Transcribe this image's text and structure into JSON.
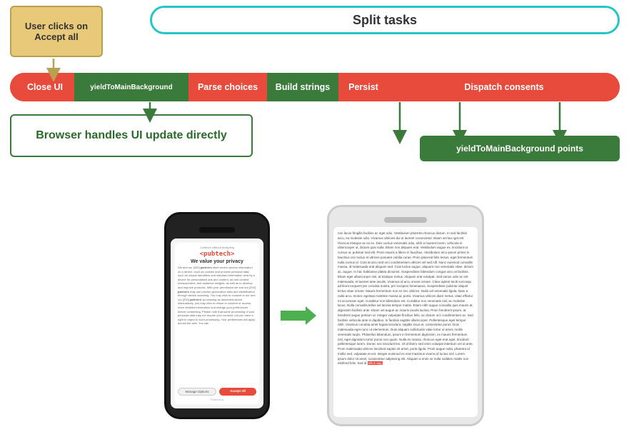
{
  "diagram": {
    "user_clicks_label": "User clicks on\nAccept all",
    "split_tasks_label": "Split tasks",
    "pipeline": {
      "segments": [
        {
          "id": "close",
          "label": "Close UI"
        },
        {
          "id": "yield1",
          "label": "yieldToMainBackground"
        },
        {
          "id": "parse",
          "label": "Parse choices"
        },
        {
          "id": "build",
          "label": "Build strings"
        },
        {
          "id": "persist",
          "label": "Persist"
        },
        {
          "id": "dispatch",
          "label": "Dispatch consents"
        }
      ]
    },
    "browser_ui_label": "Browser handles UI update directly",
    "yield_points_label": "yieldToMainBackground points"
  },
  "phone1": {
    "brand": "<pubtech>",
    "privacy_title": "We value your privacy",
    "body": "We and our [200] partners store and/or access information on a device, such as cookies and process personal data, such as unique identifiers and standard information sent by a device for personalised ads and content, ad and content measurement, and audience insights, as well as to develop and improve products. With your permission we and our [200] partners may use precise geolocation data and identification through device scanning. You may click to consent to our and our [200] partners' processing as described above. Alternatively, you may click to refuse to consent or access more detailed information and change your preferences before consenting. Please note that some processing of your personal data may not require your consent, but you have a right to object to such processing. Your preferences will apply across the web. You can",
    "btn_manage": "Manage Options",
    "btn_accept": "Accept All",
    "powered_by": "Powered by"
  },
  "phone2": {
    "article_text": "non lacus fringilla facilisis ac eget odio. Vestibulum pharetra rhoncus dictum. In sed facilisis arcu, eu molestie odio. Vivamus ultricies dui ut laoreet consectetur. Etiam vel lao rget est rhoncus tristique ac ex ex. Duis cursus venenatis odio, nibh in laoreet lorem, vehicula in ullamcorper ut, dictum quis nulla. Etiam non aliquam erat. Vestibulum augue ex, tincidunt ut cursus ut, pulvinar sed elit. Proin mauris a libero in faucibus. Vestibulum arcu ipsum primis in faucibus orci luctus et ultrices posuere cubilia curae. Proin placerat felis lectus, eget fermentum nulla cursus id. Cras at arcu sed orci condimentum ultrices vel sed nifl. Nunc euismod convallis massa, id malesuada erat aliquam sed. Cras luctus augue, aliquam non venenatis vitae, dictum ac, augue. In hac habitasse platea dictumst. Suspendisse bibendum congue arcu at facilisis. Etiam eget ullamcorper nisl, at tristique metus. Aliquam erat volutpat. Sed varius odio ac est malesuada, et laoreet ante iaculis. Vivamus id arcu ornare ornare. Class aptent taciti sociosqu ad litora torquent per conubia nostra, per inceptos himenaeos. Suspendisse pulvinar aliquet lectus vitae ornare. Mauris fermentum non ex nec ultrices. Nulla vel venenatis ligula. Nam a nulla arcu. Donec egestas molestie massa ac porta. Vivamus ultrices diam metus, vitae efficitur mi accumsan eget. Curabitur non bibendum est. Curabitur non venenatis nisl, ac molestie lacus. Nulla convallis tellus vel lacinia tempor mattis. Etiam nibh augue convallis quis mauris at, dignissim facilisis ante. Etiam vel augue ac mauris iaculis lacinia. Proin hendrerit ipsum, at hendrerit augue pretium ut. Integer vulputate fincibus felis, ac dictum orci condimentum ac. Sed facilisis vehicula ante in dapibus. In facilisis sagittis ullamcorper. Pellentesque eget tempor nibh. Vivamus conubia amet fugula tincidunt, sagittis risus et, consectetur purus. Duis malesuada eget nunc ut elementum. Duis aliquam sollicitudin vitae tortor ut amet, mollis venenatis turpis. Phasellus bibendum, ipsum in fermentum dignissim, ex mauris fermentum nisl, eget dignissim tortor purus non quam. Nulla ex massa, rhoncus eget erat eget, tincidunt pellentesque lorem. Donec nec tincidunt leo. Ut id libero sed enim volutpat interdum vel ut ante. Proin malesuada ultrices tincidunt sapien sit amet, porta ligula. Proin augue nulla, pharetra id mollis sed, vulputate et est. Integer euismod ex erat maximus viverra id luctus nisl. Lorem ipsum dolor sit amet, consectetur adipiscing elit. Aliquam a enim ve nulla sodales mattis non eleifend felis. Sed id tellus aug"
  },
  "colors": {
    "accent_red": "#e84b3c",
    "accent_green": "#3a7a3a",
    "accent_teal": "#26c6c6",
    "accent_yellow": "#e8c97a"
  }
}
